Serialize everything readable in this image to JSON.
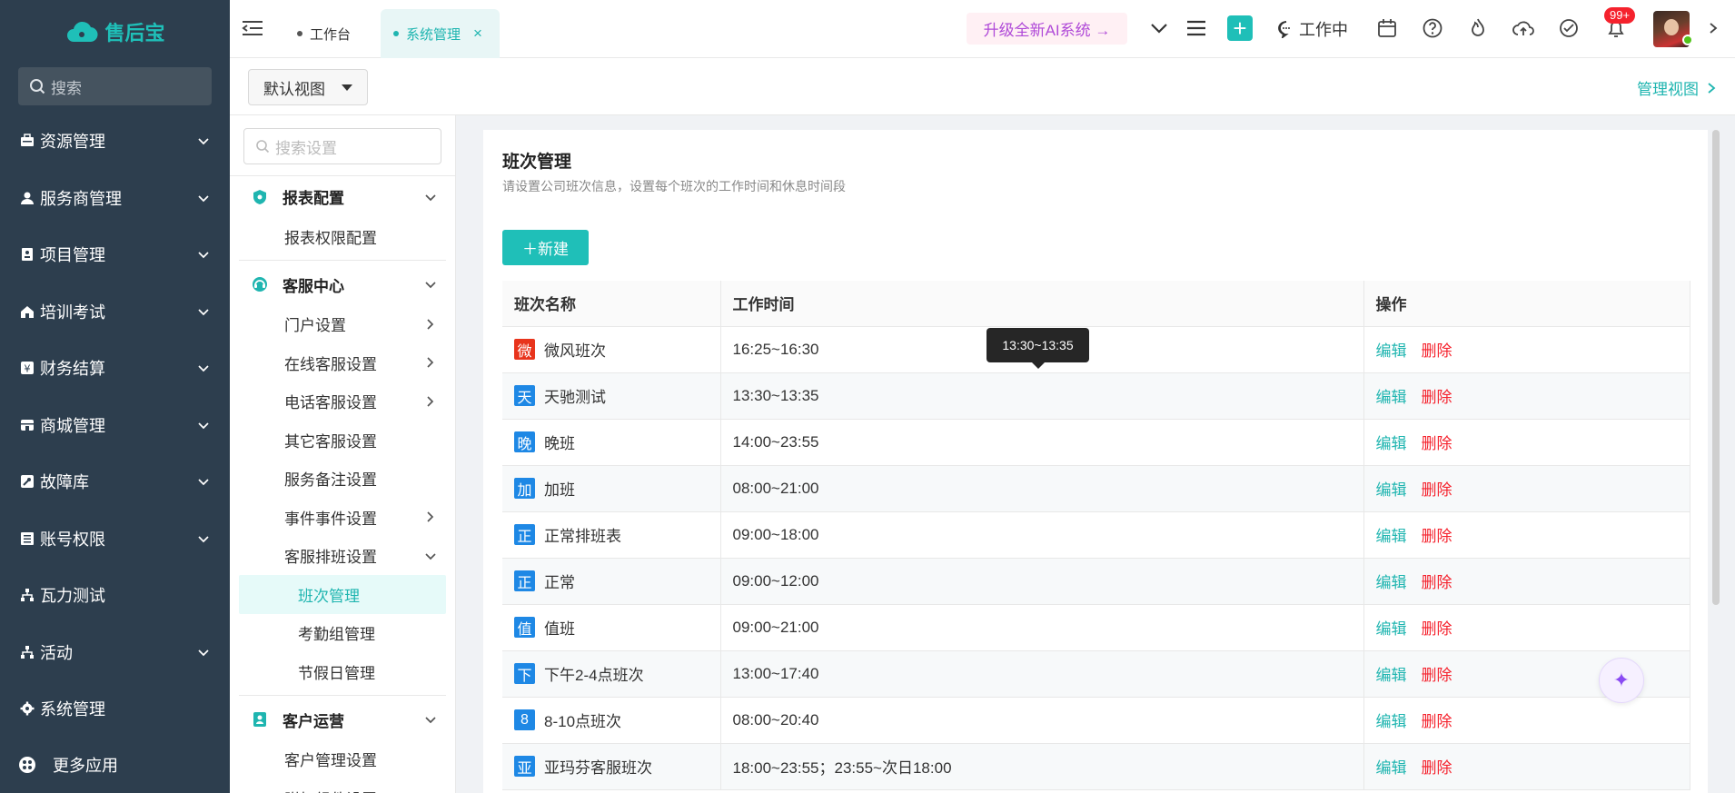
{
  "nav": {
    "logo_text": "售后宝",
    "search_placeholder": "搜索",
    "items": [
      {
        "label": "资源管理",
        "icon": "briefcase-icon",
        "has_children": true
      },
      {
        "label": "服务商管理",
        "icon": "person-icon",
        "has_children": true
      },
      {
        "label": "项目管理",
        "icon": "clipboard-icon",
        "has_children": true
      },
      {
        "label": "培训考试",
        "icon": "home-icon",
        "has_children": true
      },
      {
        "label": "财务结算",
        "icon": "yen-icon",
        "has_children": true
      },
      {
        "label": "商城管理",
        "icon": "store-icon",
        "has_children": true
      },
      {
        "label": "故障库",
        "icon": "wrench-icon",
        "has_children": true
      },
      {
        "label": "账号权限",
        "icon": "list-icon",
        "has_children": true
      },
      {
        "label": "瓦力测试",
        "icon": "org-icon",
        "has_children": false
      },
      {
        "label": "活动",
        "icon": "org-icon",
        "has_children": true
      },
      {
        "label": "系统管理",
        "icon": "gear-icon",
        "has_children": false
      }
    ],
    "more_label": "更多应用"
  },
  "topbar": {
    "tabs": [
      {
        "label": "工作台",
        "active": false
      },
      {
        "label": "系统管理",
        "active": true
      }
    ],
    "upgrade_label": "升级全新AI系统 →",
    "status_label": "工作中",
    "notification_badge": "99+"
  },
  "subheader": {
    "view_select": "默认视图",
    "manage_view_link": "管理视图"
  },
  "settings": {
    "search_placeholder": "搜索设置",
    "groups": [
      {
        "title": "报表配置",
        "icon": "shield-icon",
        "items": [
          {
            "label": "报表权限配置",
            "arrow": false
          }
        ]
      },
      {
        "title": "客服中心",
        "icon": "headset-icon",
        "items": [
          {
            "label": "门户设置",
            "arrow": true
          },
          {
            "label": "在线客服设置",
            "arrow": true
          },
          {
            "label": "电话客服设置",
            "arrow": true
          },
          {
            "label": "其它客服设置",
            "arrow": false
          },
          {
            "label": "服务备注设置",
            "arrow": false
          },
          {
            "label": "事件事件设置",
            "arrow": true
          },
          {
            "label": "客服排班设置",
            "arrow": "down"
          }
        ]
      },
      {
        "title": "客户运营",
        "icon": "contact-icon",
        "items": [
          {
            "label": "客户管理设置",
            "arrow": false
          },
          {
            "label": "附加组件设置",
            "arrow": false
          }
        ]
      }
    ],
    "schedule_subitems": [
      {
        "label": "班次管理",
        "active": true
      },
      {
        "label": "考勤组管理",
        "active": false
      },
      {
        "label": "节假日管理",
        "active": false
      }
    ]
  },
  "content": {
    "title": "班次管理",
    "description": "请设置公司班次信息，设置每个班次的工作时间和休息时间段",
    "new_button": "＋新建",
    "columns": [
      "班次名称",
      "工作时间",
      "操作"
    ],
    "edit_label": "编辑",
    "delete_label": "删除",
    "rows": [
      {
        "tag": "微",
        "tag_color": "#e8341c",
        "name": "微风班次",
        "time": "16:25~16:30"
      },
      {
        "tag": "天",
        "tag_color": "#1e88e5",
        "name": "天驰测试",
        "time": "13:30~13:35"
      },
      {
        "tag": "晚",
        "tag_color": "#1e88e5",
        "name": "晚班",
        "time": "14:00~23:55"
      },
      {
        "tag": "加",
        "tag_color": "#1e88e5",
        "name": "加班",
        "time": "08:00~21:00"
      },
      {
        "tag": "正",
        "tag_color": "#1e88e5",
        "name": "正常排班表",
        "time": "09:00~18:00"
      },
      {
        "tag": "正",
        "tag_color": "#1e88e5",
        "name": "正常",
        "time": "09:00~12:00"
      },
      {
        "tag": "值",
        "tag_color": "#1e88e5",
        "name": "值班",
        "time": "09:00~21:00"
      },
      {
        "tag": "下",
        "tag_color": "#1e88e5",
        "name": "下午2-4点班次",
        "time": "13:00~17:40"
      },
      {
        "tag": "8",
        "tag_color": "#1e88e5",
        "name": "8-10点班次",
        "time": "08:00~20:40"
      },
      {
        "tag": "亚",
        "tag_color": "#1e88e5",
        "name": "亚玛芬客服班次",
        "time": "18:00~23:55；23:55~次日18:00"
      }
    ],
    "tooltip": "13:30~13:35"
  },
  "colors": {
    "accent": "#1fbfb8",
    "nav_bg": "#2d3e4e",
    "danger": "#f5222d"
  }
}
